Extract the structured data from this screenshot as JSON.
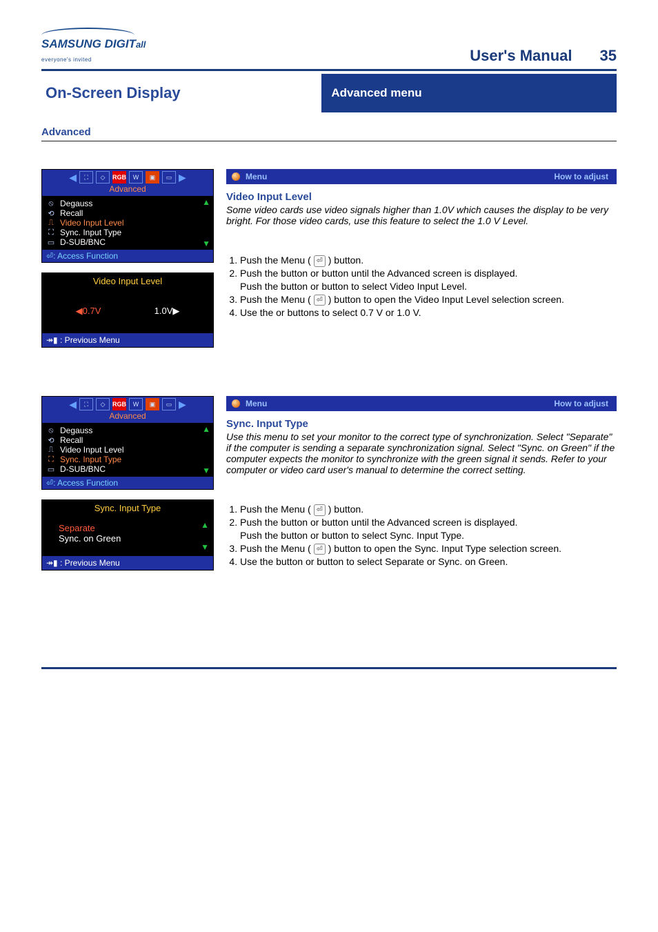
{
  "header": {
    "logo_main": "SAMSUNG DIGIT",
    "logo_suffix": "all",
    "logo_sub": "everyone's invited",
    "title": "User's Manual",
    "page_number": "35"
  },
  "banner": {
    "left": "On-Screen Display",
    "right": "Advanced menu"
  },
  "intro": "Advanced",
  "osd": {
    "tab_label": "Advanced",
    "items": [
      {
        "icon": "⦸",
        "label": "Degauss"
      },
      {
        "icon": "⟲",
        "label": "Recall"
      },
      {
        "icon": "⎍",
        "label": "Video Input Level"
      },
      {
        "icon": "⛶",
        "label": "Sync. Input Type"
      },
      {
        "icon": "▭",
        "label": "D-SUB/BNC"
      }
    ],
    "access": ": Access Function",
    "previous": ": Previous Menu"
  },
  "section1": {
    "bar_label": "Menu",
    "bar_sub": "How to adjust",
    "title": "Video Input Level",
    "desc": "Some video cards use video signals higher than 1.0V which causes the display to be very bright. For those video cards, use this feature to select the 1.0 V Level.",
    "osd_sub_title": "Video Input Level",
    "options": {
      "a": "0.7V",
      "b": "1.0V"
    },
    "steps": {
      "s1": "Push the Menu (",
      "s1b": ") button.",
      "s2a": "Push the ",
      "s2b": " button or ",
      "s2c": " button until the Advanced screen is displayed.",
      "s2d": "Push the ",
      "s2e": " button or ",
      "s2f": " button to select Video Input Level.",
      "s3a": "Push the Menu ( ",
      "s3b": " ) button to open the Video Input Level selection screen.",
      "s4a": "Use the ",
      "s4b": " or ",
      "s4c": " buttons to select 0.7 V or 1.0 V."
    }
  },
  "section2": {
    "bar_label": "Menu",
    "bar_sub": "How to adjust",
    "title": "Sync. Input Type",
    "desc": "Use this menu to set your monitor to the correct type of synchronization. Select \"Separate\" if the computer is sending a separate synchronization signal. Select \"Sync. on Green\" if the computer expects the monitor to synchronize with the green signal it sends. Refer to your computer or video card user's manual to determine the correct setting.",
    "osd_sub_title": "Sync. Input Type",
    "options": {
      "a": "Separate",
      "b": "Sync. on Green"
    },
    "steps": {
      "s1": "Push the Menu (",
      "s1b": ") button.",
      "s2a": "Push the ",
      "s2b": " button or ",
      "s2c": " button until the Advanced screen is displayed.",
      "s2d": "Push the ",
      "s2e": " button or ",
      "s2f": " button to select Sync. Input Type.",
      "s3a": "Push the Menu ( ",
      "s3b": " ) button to open the Sync. Input Type selection screen.",
      "s4a": "Use the ",
      "s4b": " button or ",
      "s4c": " button to select Separate or Sync. on Green."
    }
  }
}
